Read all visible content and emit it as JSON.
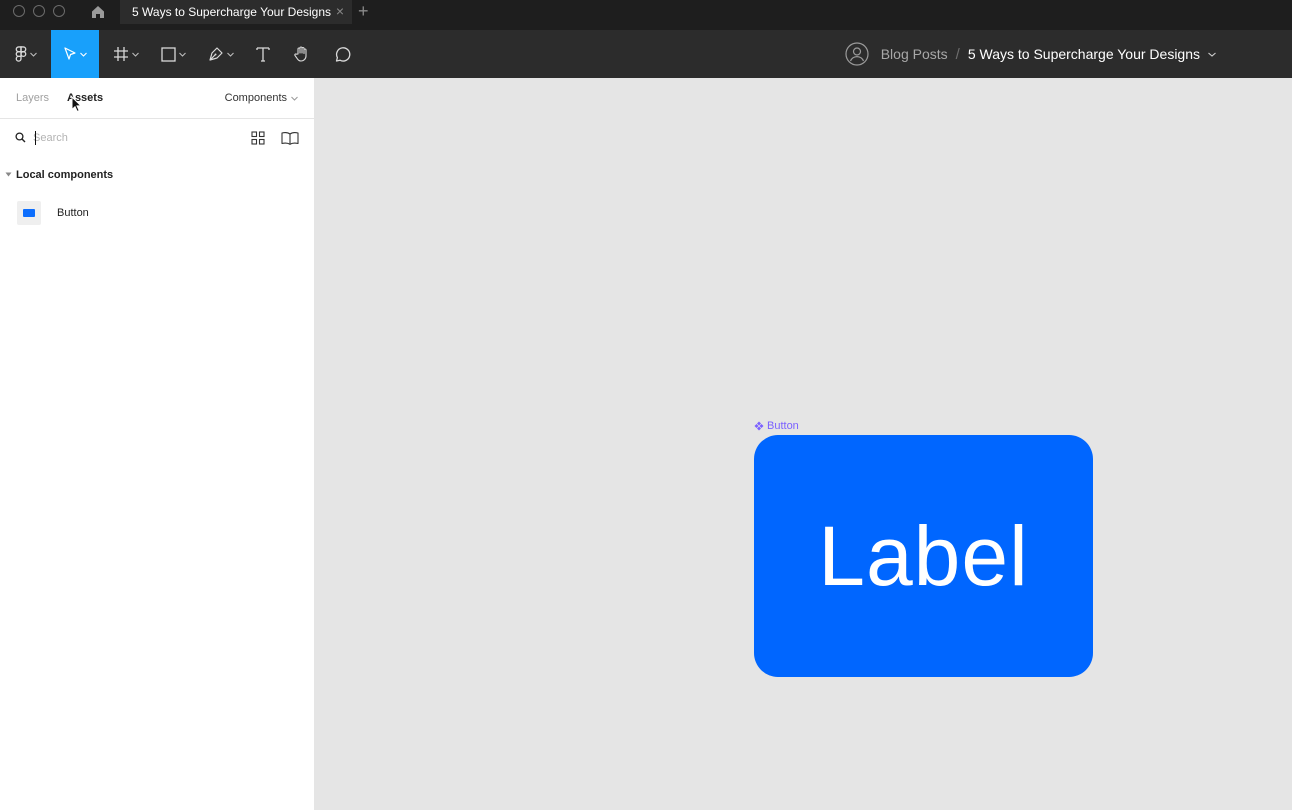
{
  "window": {
    "tab_title": "5 Ways to Supercharge Your Designs",
    "tab_close": "×",
    "new_tab": "+"
  },
  "toolbar": {
    "breadcrumb_folder": "Blog Posts",
    "breadcrumb_separator": "/",
    "breadcrumb_file": "5 Ways to Supercharge Your Designs",
    "active_tool": "move"
  },
  "left_panel": {
    "tabs": [
      {
        "label": "Layers",
        "active": false
      },
      {
        "label": "Assets",
        "active": true
      }
    ],
    "library_dropdown": "Components",
    "search": {
      "placeholder": "Search",
      "value": ""
    },
    "section_title": "Local components",
    "components": [
      {
        "name": "Button"
      }
    ]
  },
  "canvas": {
    "frame_label": "Button",
    "button_label": "Label"
  },
  "colors": {
    "accent": "#18a0fb",
    "component_fill": "#0066ff",
    "component_label": "#7b61ff"
  }
}
